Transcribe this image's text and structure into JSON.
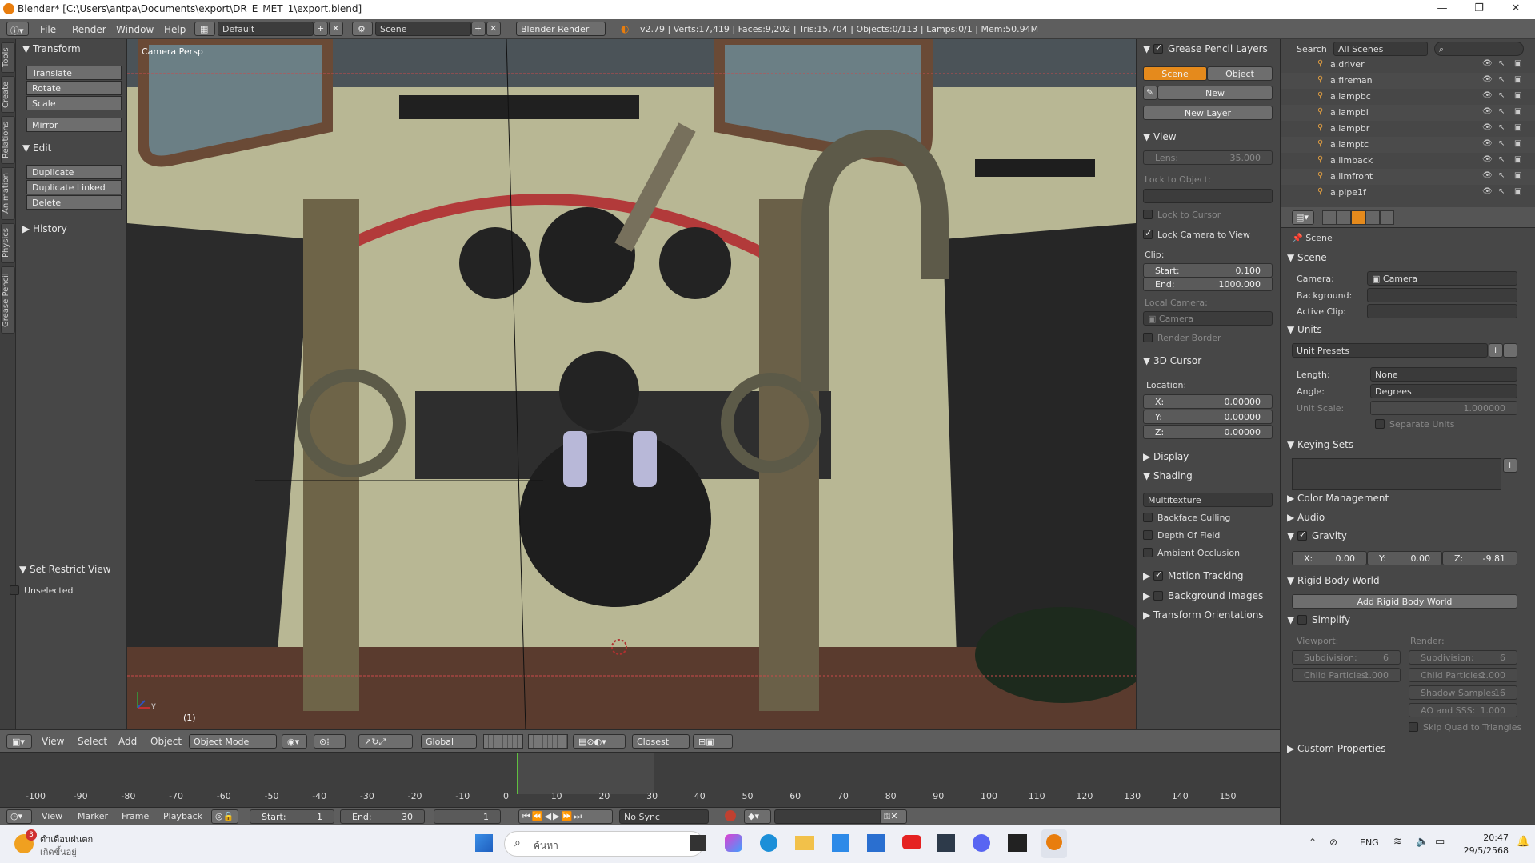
{
  "window": {
    "title": "Blender* [C:\\Users\\antpa\\Documents\\export\\DR_E_MET_1\\export.blend]"
  },
  "infobar": {
    "menus": [
      "File",
      "Render",
      "Window",
      "Help"
    ],
    "layout": "Default",
    "scene": "Scene",
    "engine": "Blender Render",
    "stats": "v2.79 | Verts:17,419 | Faces:9,202 | Tris:15,704 | Objects:0/113 | Lamps:0/1 | Mem:50.94M"
  },
  "lefttabs": [
    "Tools",
    "Create",
    "Relations",
    "Animation",
    "Physics",
    "Grease Pencil"
  ],
  "toolshelf": {
    "transform": "Transform",
    "translate": "Translate",
    "rotate": "Rotate",
    "scale": "Scale",
    "mirror": "Mirror",
    "edit": "Edit",
    "duplicate": "Duplicate",
    "duplicate_linked": "Duplicate Linked",
    "delete": "Delete",
    "history": "History",
    "restrict": "Set Restrict View",
    "unselected": "Unselected"
  },
  "viewport": {
    "label": "Camera Persp",
    "frame": "(1)",
    "axis_y": "y"
  },
  "npanel": {
    "gp_layers": "Grease Pencil Layers",
    "scene_tab": "Scene",
    "object_tab": "Object",
    "new": "New",
    "new_layer": "New Layer",
    "view": "View",
    "lens_label": "Lens:",
    "lens": "35.000",
    "lock_obj": "Lock to Object:",
    "lock_cursor": "Lock to Cursor",
    "lock_camera": "Lock Camera to View",
    "clip": "Clip:",
    "start_label": "Start:",
    "start": "0.100",
    "end_label": "End:",
    "end": "1000.000",
    "local_camera": "Local Camera:",
    "camera": "Camera",
    "render_border": "Render Border",
    "cursor": "3D Cursor",
    "location": "Location:",
    "x_label": "X:",
    "y_label": "Y:",
    "z_label": "Z:",
    "x": "0.00000",
    "y": "0.00000",
    "z": "0.00000",
    "display": "Display",
    "shading": "Shading",
    "multitexture": "Multitexture",
    "backface": "Backface Culling",
    "dof": "Depth Of Field",
    "ao": "Ambient Occlusion",
    "motion": "Motion Tracking",
    "bgimages": "Background Images",
    "orient": "Transform Orientations"
  },
  "outliner": {
    "search": "Search",
    "scenes": "All Scenes",
    "items": [
      "a.driver",
      "a.fireman",
      "a.lampbc",
      "a.lampbl",
      "a.lampbr",
      "a.lamptc",
      "a.limback",
      "a.limfront",
      "a.pipe1f"
    ]
  },
  "props": {
    "breadcrumb": "Scene",
    "scene": "Scene",
    "camera_label": "Camera:",
    "camera": "Camera",
    "background": "Background:",
    "active_clip": "Active Clip:",
    "units": "Units",
    "unit_presets": "Unit Presets",
    "length_label": "Length:",
    "length": "None",
    "angle_label": "Angle:",
    "angle": "Degrees",
    "unit_scale_label": "Unit Scale:",
    "unit_scale": "1.000000",
    "separate_units": "Separate Units",
    "keying_sets": "Keying Sets",
    "color_mgmt": "Color Management",
    "audio": "Audio",
    "gravity": "Gravity",
    "gx_label": "X:",
    "gx": "0.00",
    "gy_label": "Y:",
    "gy": "0.00",
    "gz_label": "Z:",
    "gz": "-9.81",
    "rigid": "Rigid Body World",
    "add_rigid": "Add Rigid Body World",
    "simplify": "Simplify",
    "viewport": "Viewport:",
    "render": "Render:",
    "subdiv_label": "Subdivision:",
    "subdiv_v": "6",
    "subdiv_r": "6",
    "child_label": "Child Particles:",
    "child_v": "1.000",
    "child_r": "1.000",
    "shadow_label": "Shadow Samples:",
    "shadow": "16",
    "aosss_label": "AO and SSS:",
    "aosss": "1.000",
    "skip_quad": "Skip Quad to Triangles",
    "custom": "Custom Properties"
  },
  "vpheader": {
    "view": "View",
    "select": "Select",
    "add": "Add",
    "object": "Object",
    "mode": "Object Mode",
    "orientation": "Global",
    "snap": "Closest"
  },
  "timeline": {
    "ticks": [
      "-100",
      "-90",
      "-80",
      "-70",
      "-60",
      "-50",
      "-40",
      "-30",
      "-20",
      "-10",
      "0",
      "10",
      "20",
      "30",
      "40",
      "50",
      "60",
      "70",
      "80",
      "90",
      "100",
      "110",
      "120",
      "130",
      "140",
      "150"
    ],
    "view": "View",
    "marker": "Marker",
    "frame": "Frame",
    "playback": "Playback",
    "start_label": "Start:",
    "start": "1",
    "end_label": "End:",
    "end": "30",
    "current": "1",
    "sync": "No Sync"
  },
  "taskbar": {
    "notif_title": "ตำเตือนฝนตก",
    "notif_sub": "เกิดขึ้นอยู่",
    "search": "ค้นหา",
    "lang": "ENG",
    "time": "20:47",
    "date": "29/5/2568",
    "badge": "3"
  }
}
